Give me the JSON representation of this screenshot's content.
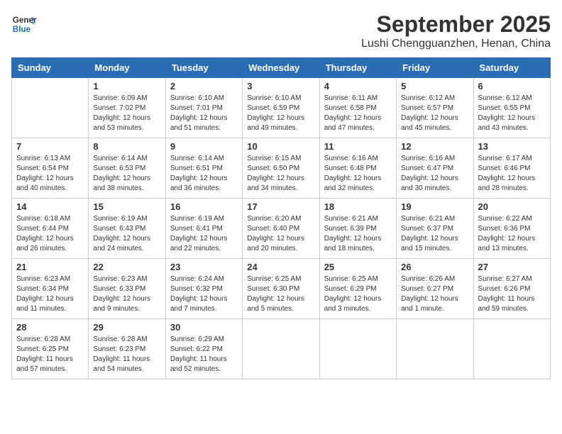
{
  "header": {
    "logo_line1": "General",
    "logo_line2": "Blue",
    "month_title": "September 2025",
    "location": "Lushi Chengguanzhen, Henan, China"
  },
  "weekdays": [
    "Sunday",
    "Monday",
    "Tuesday",
    "Wednesday",
    "Thursday",
    "Friday",
    "Saturday"
  ],
  "weeks": [
    [
      {
        "day": "",
        "sunrise": "",
        "sunset": "",
        "daylight": ""
      },
      {
        "day": "1",
        "sunrise": "Sunrise: 6:09 AM",
        "sunset": "Sunset: 7:02 PM",
        "daylight": "Daylight: 12 hours and 53 minutes."
      },
      {
        "day": "2",
        "sunrise": "Sunrise: 6:10 AM",
        "sunset": "Sunset: 7:01 PM",
        "daylight": "Daylight: 12 hours and 51 minutes."
      },
      {
        "day": "3",
        "sunrise": "Sunrise: 6:10 AM",
        "sunset": "Sunset: 6:59 PM",
        "daylight": "Daylight: 12 hours and 49 minutes."
      },
      {
        "day": "4",
        "sunrise": "Sunrise: 6:11 AM",
        "sunset": "Sunset: 6:58 PM",
        "daylight": "Daylight: 12 hours and 47 minutes."
      },
      {
        "day": "5",
        "sunrise": "Sunrise: 6:12 AM",
        "sunset": "Sunset: 6:57 PM",
        "daylight": "Daylight: 12 hours and 45 minutes."
      },
      {
        "day": "6",
        "sunrise": "Sunrise: 6:12 AM",
        "sunset": "Sunset: 6:55 PM",
        "daylight": "Daylight: 12 hours and 43 minutes."
      }
    ],
    [
      {
        "day": "7",
        "sunrise": "Sunrise: 6:13 AM",
        "sunset": "Sunset: 6:54 PM",
        "daylight": "Daylight: 12 hours and 40 minutes."
      },
      {
        "day": "8",
        "sunrise": "Sunrise: 6:14 AM",
        "sunset": "Sunset: 6:53 PM",
        "daylight": "Daylight: 12 hours and 38 minutes."
      },
      {
        "day": "9",
        "sunrise": "Sunrise: 6:14 AM",
        "sunset": "Sunset: 6:51 PM",
        "daylight": "Daylight: 12 hours and 36 minutes."
      },
      {
        "day": "10",
        "sunrise": "Sunrise: 6:15 AM",
        "sunset": "Sunset: 6:50 PM",
        "daylight": "Daylight: 12 hours and 34 minutes."
      },
      {
        "day": "11",
        "sunrise": "Sunrise: 6:16 AM",
        "sunset": "Sunset: 6:48 PM",
        "daylight": "Daylight: 12 hours and 32 minutes."
      },
      {
        "day": "12",
        "sunrise": "Sunrise: 6:16 AM",
        "sunset": "Sunset: 6:47 PM",
        "daylight": "Daylight: 12 hours and 30 minutes."
      },
      {
        "day": "13",
        "sunrise": "Sunrise: 6:17 AM",
        "sunset": "Sunset: 6:46 PM",
        "daylight": "Daylight: 12 hours and 28 minutes."
      }
    ],
    [
      {
        "day": "14",
        "sunrise": "Sunrise: 6:18 AM",
        "sunset": "Sunset: 6:44 PM",
        "daylight": "Daylight: 12 hours and 26 minutes."
      },
      {
        "day": "15",
        "sunrise": "Sunrise: 6:19 AM",
        "sunset": "Sunset: 6:43 PM",
        "daylight": "Daylight: 12 hours and 24 minutes."
      },
      {
        "day": "16",
        "sunrise": "Sunrise: 6:19 AM",
        "sunset": "Sunset: 6:41 PM",
        "daylight": "Daylight: 12 hours and 22 minutes."
      },
      {
        "day": "17",
        "sunrise": "Sunrise: 6:20 AM",
        "sunset": "Sunset: 6:40 PM",
        "daylight": "Daylight: 12 hours and 20 minutes."
      },
      {
        "day": "18",
        "sunrise": "Sunrise: 6:21 AM",
        "sunset": "Sunset: 6:39 PM",
        "daylight": "Daylight: 12 hours and 18 minutes."
      },
      {
        "day": "19",
        "sunrise": "Sunrise: 6:21 AM",
        "sunset": "Sunset: 6:37 PM",
        "daylight": "Daylight: 12 hours and 15 minutes."
      },
      {
        "day": "20",
        "sunrise": "Sunrise: 6:22 AM",
        "sunset": "Sunset: 6:36 PM",
        "daylight": "Daylight: 12 hours and 13 minutes."
      }
    ],
    [
      {
        "day": "21",
        "sunrise": "Sunrise: 6:23 AM",
        "sunset": "Sunset: 6:34 PM",
        "daylight": "Daylight: 12 hours and 11 minutes."
      },
      {
        "day": "22",
        "sunrise": "Sunrise: 6:23 AM",
        "sunset": "Sunset: 6:33 PM",
        "daylight": "Daylight: 12 hours and 9 minutes."
      },
      {
        "day": "23",
        "sunrise": "Sunrise: 6:24 AM",
        "sunset": "Sunset: 6:32 PM",
        "daylight": "Daylight: 12 hours and 7 minutes."
      },
      {
        "day": "24",
        "sunrise": "Sunrise: 6:25 AM",
        "sunset": "Sunset: 6:30 PM",
        "daylight": "Daylight: 12 hours and 5 minutes."
      },
      {
        "day": "25",
        "sunrise": "Sunrise: 6:25 AM",
        "sunset": "Sunset: 6:29 PM",
        "daylight": "Daylight: 12 hours and 3 minutes."
      },
      {
        "day": "26",
        "sunrise": "Sunrise: 6:26 AM",
        "sunset": "Sunset: 6:27 PM",
        "daylight": "Daylight: 12 hours and 1 minute."
      },
      {
        "day": "27",
        "sunrise": "Sunrise: 6:27 AM",
        "sunset": "Sunset: 6:26 PM",
        "daylight": "Daylight: 11 hours and 59 minutes."
      }
    ],
    [
      {
        "day": "28",
        "sunrise": "Sunrise: 6:28 AM",
        "sunset": "Sunset: 6:25 PM",
        "daylight": "Daylight: 11 hours and 57 minutes."
      },
      {
        "day": "29",
        "sunrise": "Sunrise: 6:28 AM",
        "sunset": "Sunset: 6:23 PM",
        "daylight": "Daylight: 11 hours and 54 minutes."
      },
      {
        "day": "30",
        "sunrise": "Sunrise: 6:29 AM",
        "sunset": "Sunset: 6:22 PM",
        "daylight": "Daylight: 11 hours and 52 minutes."
      },
      {
        "day": "",
        "sunrise": "",
        "sunset": "",
        "daylight": ""
      },
      {
        "day": "",
        "sunrise": "",
        "sunset": "",
        "daylight": ""
      },
      {
        "day": "",
        "sunrise": "",
        "sunset": "",
        "daylight": ""
      },
      {
        "day": "",
        "sunrise": "",
        "sunset": "",
        "daylight": ""
      }
    ]
  ]
}
